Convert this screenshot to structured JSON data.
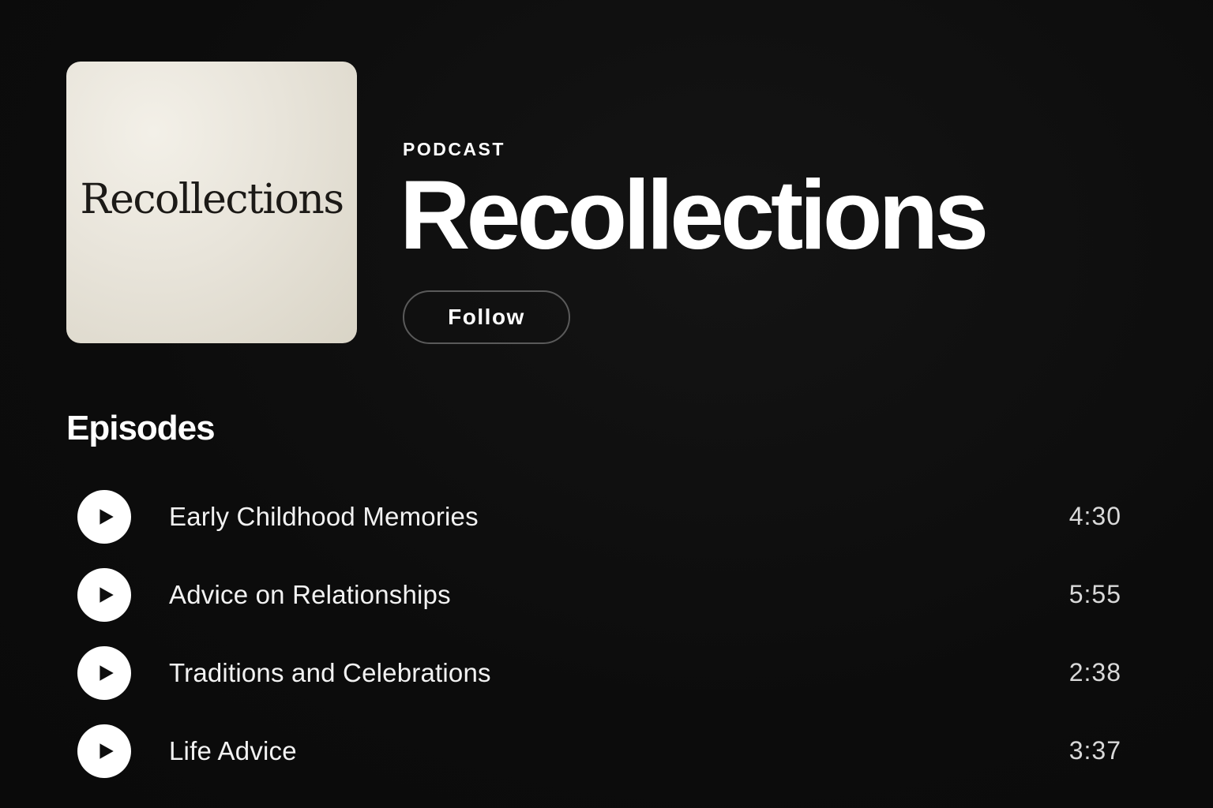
{
  "podcast": {
    "cover_text": "Recollections",
    "kind_label": "PODCAST",
    "title": "Recollections",
    "follow_label": "Follow"
  },
  "episodes_section": {
    "heading": "Episodes",
    "items": [
      {
        "title": "Early Childhood Memories",
        "duration": "4:30"
      },
      {
        "title": "Advice on Relationships",
        "duration": "5:55"
      },
      {
        "title": "Traditions and Celebrations",
        "duration": "2:38"
      },
      {
        "title": "Life Advice",
        "duration": "3:37"
      }
    ]
  },
  "icons": {
    "play": "play-icon"
  },
  "colors": {
    "background": "#0d0d0d",
    "text": "#ffffff",
    "cover": "#e8e4da"
  }
}
